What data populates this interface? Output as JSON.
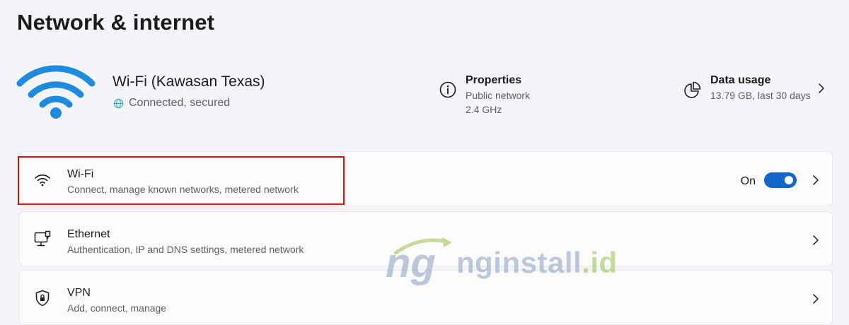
{
  "page": {
    "title": "Network & internet"
  },
  "hero": {
    "network_name": "Wi-Fi (Kawasan Texas)",
    "status": "Connected, secured",
    "properties": {
      "title": "Properties",
      "line1": "Public network",
      "line2": "2.4 GHz"
    },
    "data_usage": {
      "title": "Data usage",
      "value": "13.79 GB, last 30 days"
    }
  },
  "cards": {
    "wifi": {
      "title": "Wi-Fi",
      "subtitle": "Connect, manage known networks, metered network",
      "toggle_label": "On",
      "toggle_on": true
    },
    "ethernet": {
      "title": "Ethernet",
      "subtitle": "Authentication, IP and DNS settings, metered network"
    },
    "vpn": {
      "title": "VPN",
      "subtitle": "Add, connect, manage"
    }
  },
  "watermark": {
    "text_main": "nginstall",
    "text_ext": ".id"
  },
  "colors": {
    "accent": "#1366c8",
    "hero_icon": "#1e8be0",
    "highlight": "#d01515",
    "background": "#f3f5f9",
    "card": "#fbfbfc"
  }
}
